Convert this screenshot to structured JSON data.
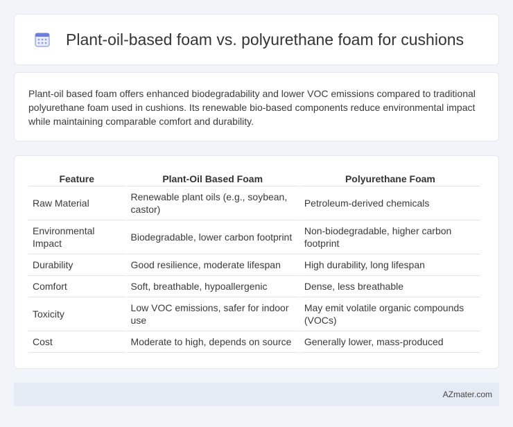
{
  "header": {
    "title": "Plant-oil-based foam vs. polyurethane foam for cushions",
    "icon": "calendar-icon",
    "icon_color": "#6b7fd6"
  },
  "summary": {
    "text": "Plant-oil based foam offers enhanced biodegradability and lower VOC emissions compared to traditional polyurethane foam used in cushions. Its renewable bio-based components reduce environmental impact while maintaining comparable comfort and durability."
  },
  "table": {
    "headers": [
      "Feature",
      "Plant-Oil Based Foam",
      "Polyurethane Foam"
    ],
    "rows": [
      [
        "Raw Material",
        "Renewable plant oils (e.g., soybean, castor)",
        "Petroleum-derived chemicals"
      ],
      [
        "Environmental Impact",
        "Biodegradable, lower carbon footprint",
        "Non-biodegradable, higher carbon footprint"
      ],
      [
        "Durability",
        "Good resilience, moderate lifespan",
        "High durability, long lifespan"
      ],
      [
        "Comfort",
        "Soft, breathable, hypoallergenic",
        "Dense, less breathable"
      ],
      [
        "Toxicity",
        "Low VOC emissions, safer for indoor use",
        "May emit volatile organic compounds (VOCs)"
      ],
      [
        "Cost",
        "Moderate to high, depends on source",
        "Generally lower, mass-produced"
      ]
    ]
  },
  "footer": {
    "text": "AZmater.com"
  }
}
